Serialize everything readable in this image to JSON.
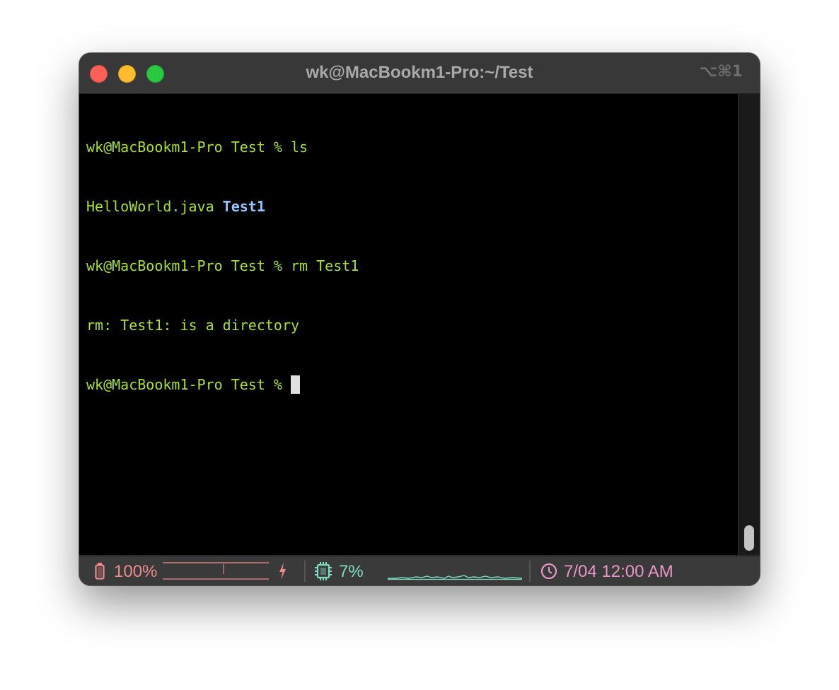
{
  "window": {
    "title": "wk@MacBookm1-Pro:~/Test",
    "shortcut": "⌥⌘1"
  },
  "terminal": {
    "line1": "wk@MacBookm1-Pro Test % ls",
    "line2_file": "HelloWorld.java",
    "line2_dir": "Test1",
    "line3": "wk@MacBookm1-Pro Test % rm Test1",
    "line4": "rm: Test1: is a directory",
    "line5_prompt": "wk@MacBookm1-Pro Test % ",
    "text_color": "#a6e22e",
    "dir_color": "#8fc7ff"
  },
  "statusbar": {
    "battery": "100%",
    "battery_icon": "battery-icon",
    "charging_icon": "bolt-icon",
    "cpu": "7%",
    "cpu_icon": "cpu-chip-icon",
    "clock_icon": "clock-icon",
    "datetime": "7/04 12:00 AM",
    "battery_color": "#ee8a8a",
    "cpu_color": "#7fdcc4",
    "clock_color": "#e995c9"
  }
}
